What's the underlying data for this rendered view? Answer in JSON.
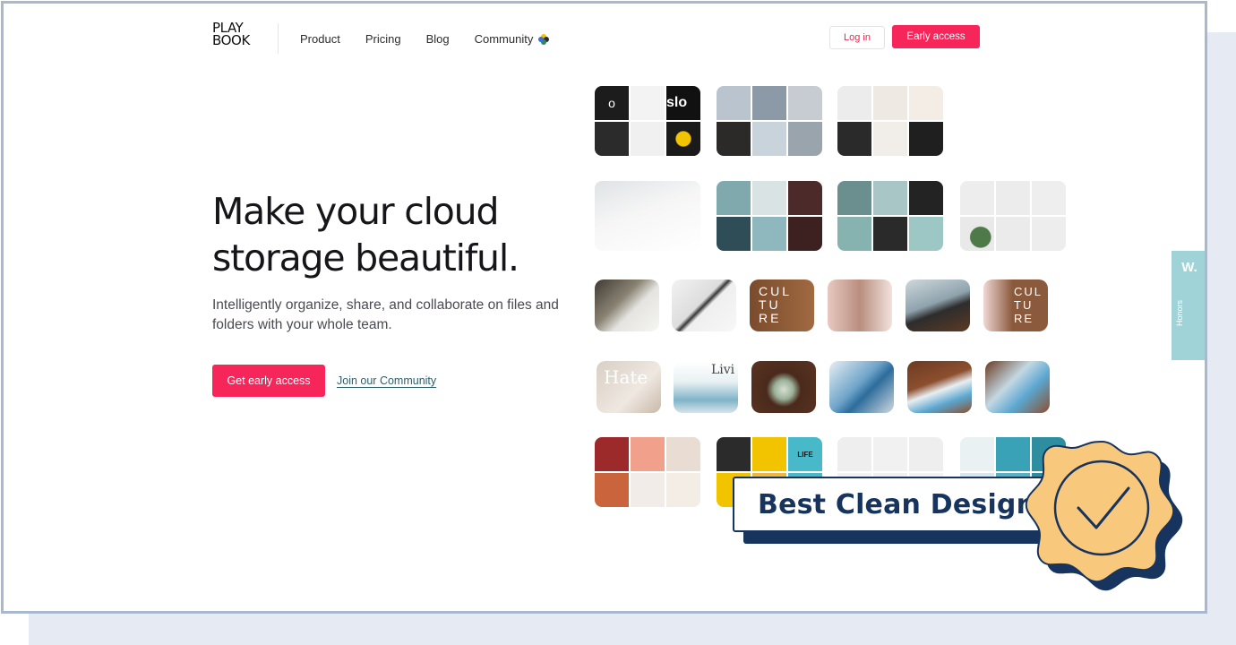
{
  "brand": {
    "logo_line1": "PLAY",
    "logo_line2": "BOOK"
  },
  "nav": {
    "items": [
      {
        "label": "Product"
      },
      {
        "label": "Pricing"
      },
      {
        "label": "Blog"
      },
      {
        "label": "Community"
      }
    ]
  },
  "header_actions": {
    "login_label": "Log in",
    "early_access_label": "Early access"
  },
  "hero": {
    "title_line1": "Make your cloud",
    "title_line2": "storage beautiful.",
    "subtitle": "Intelligently organize, share, and collaborate on files and folders with your whole team.",
    "cta_label": "Get early access",
    "community_link": "Join our Community"
  },
  "gallery": {
    "thumbnail_texts": {
      "t1": "o",
      "t2": "slo",
      "t3": "CUL TU RE",
      "t4": "CUL TU RE",
      "t5": "Hate",
      "t6": "Livi",
      "t7": "LIFE"
    }
  },
  "awards_tab": {
    "logo": "W.",
    "label": "Honors"
  },
  "badge": {
    "label": "Best Clean Design"
  },
  "colors": {
    "accent": "#f7265a",
    "navy": "#16345e",
    "seal": "#f8c97d",
    "teal_tab": "#9fd3d8"
  },
  "icons": {
    "community": "clover-icon",
    "seal": "checkmark-seal-icon"
  }
}
